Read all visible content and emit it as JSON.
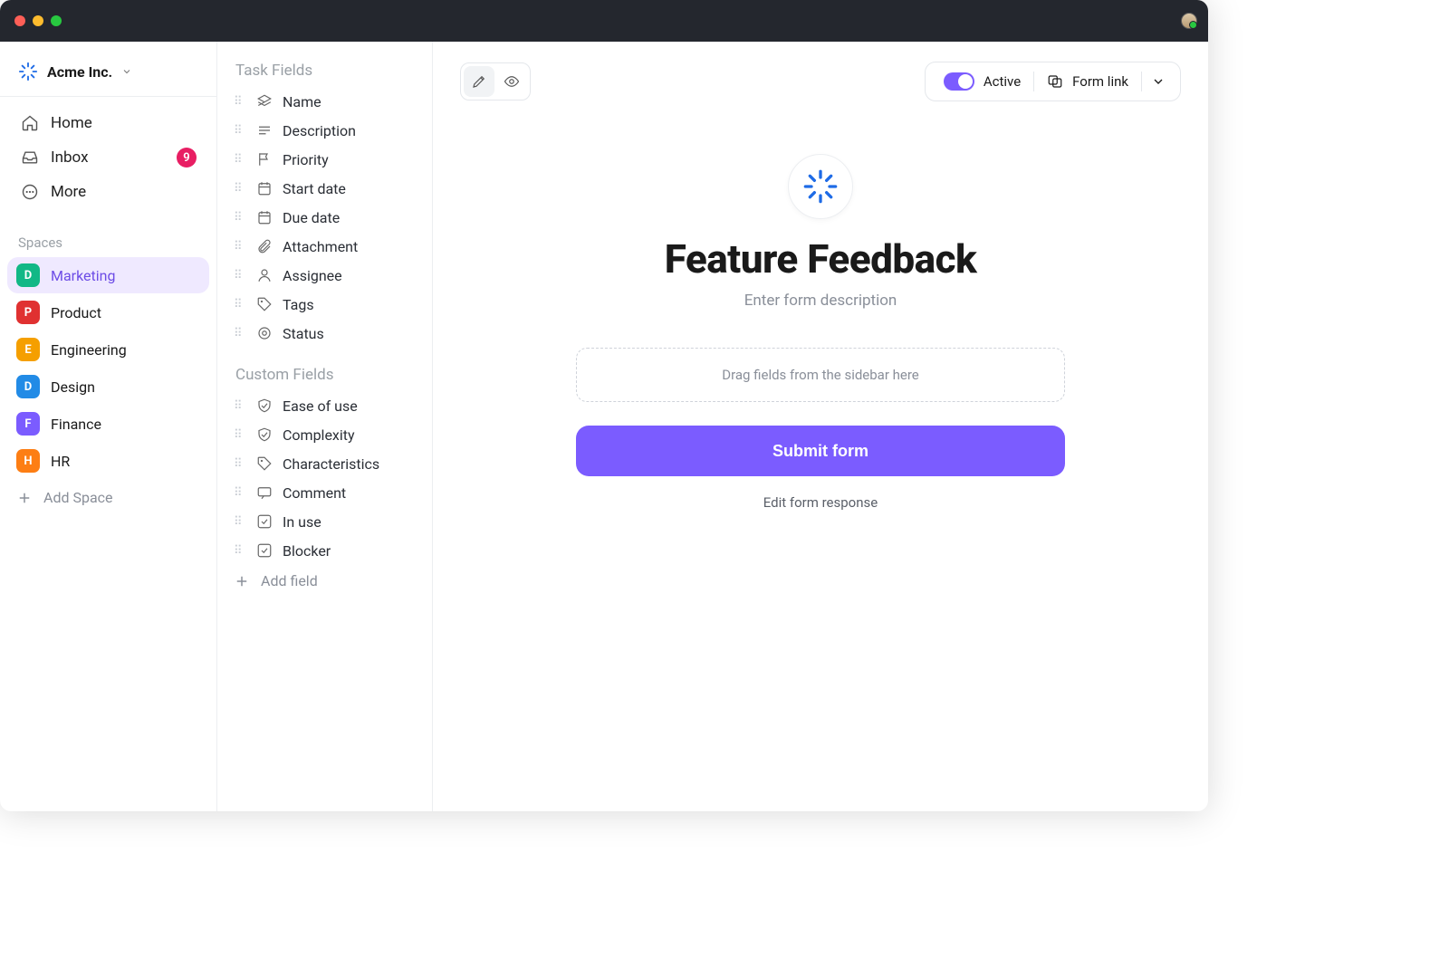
{
  "workspace": {
    "name": "Acme Inc."
  },
  "nav": {
    "home": "Home",
    "inbox": "Inbox",
    "inbox_badge": "9",
    "more": "More"
  },
  "sections": {
    "spaces": "Spaces"
  },
  "spaces": [
    {
      "letter": "D",
      "label": "Marketing",
      "color": "#12b886",
      "active": true
    },
    {
      "letter": "P",
      "label": "Product",
      "color": "#e03131",
      "active": false
    },
    {
      "letter": "E",
      "label": "Engineering",
      "color": "#f59f00",
      "active": false
    },
    {
      "letter": "D",
      "label": "Design",
      "color": "#228be6",
      "active": false
    },
    {
      "letter": "F",
      "label": "Finance",
      "color": "#7b5cff",
      "active": false
    },
    {
      "letter": "H",
      "label": "HR",
      "color": "#fd7e14",
      "active": false
    }
  ],
  "add_space": "Add Space",
  "field_groups": {
    "task": "Task Fields",
    "custom": "Custom Fields"
  },
  "task_fields": [
    {
      "label": "Name",
      "icon": "layers"
    },
    {
      "label": "Description",
      "icon": "lines"
    },
    {
      "label": "Priority",
      "icon": "flag"
    },
    {
      "label": "Start date",
      "icon": "calendar"
    },
    {
      "label": "Due date",
      "icon": "calendar"
    },
    {
      "label": "Attachment",
      "icon": "paperclip"
    },
    {
      "label": "Assignee",
      "icon": "user"
    },
    {
      "label": "Tags",
      "icon": "tag"
    },
    {
      "label": "Status",
      "icon": "target"
    }
  ],
  "custom_fields": [
    {
      "label": "Ease of use",
      "icon": "shield"
    },
    {
      "label": "Complexity",
      "icon": "shield"
    },
    {
      "label": "Characteristics",
      "icon": "tag"
    },
    {
      "label": "Comment",
      "icon": "comment"
    },
    {
      "label": "In use",
      "icon": "check"
    },
    {
      "label": "Blocker",
      "icon": "check"
    }
  ],
  "add_field": "Add field",
  "toolbar": {
    "active": "Active",
    "form_link": "Form link"
  },
  "form": {
    "title": "Feature Feedback",
    "description_placeholder": "Enter form description",
    "dropzone": "Drag fields from the sidebar here",
    "submit": "Submit form",
    "edit_response": "Edit form response"
  }
}
